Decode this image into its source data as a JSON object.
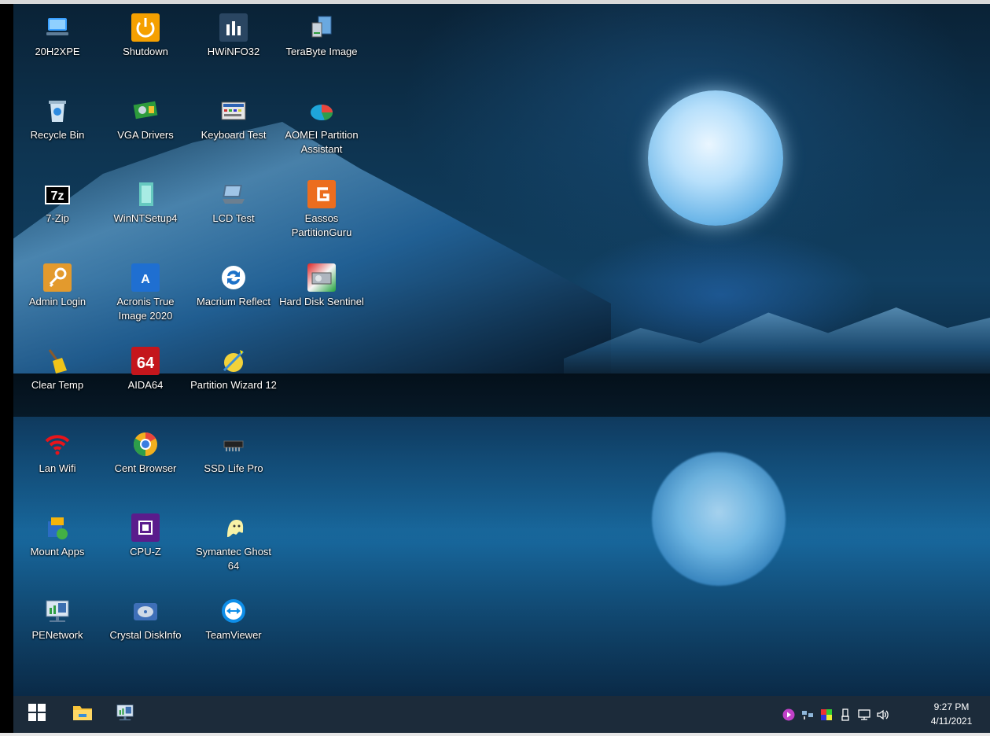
{
  "desktop": {
    "icons": [
      {
        "label": "20H2XPE",
        "icon": "computer-icon"
      },
      {
        "label": "Shutdown",
        "icon": "power-icon"
      },
      {
        "label": "HWiNFO32",
        "icon": "hwinfo-icon"
      },
      {
        "label": "TeraByte Image",
        "icon": "terabyte-icon"
      },
      {
        "label": "Recycle Bin",
        "icon": "recycle-bin-icon"
      },
      {
        "label": "VGA Drivers",
        "icon": "graphics-card-icon"
      },
      {
        "label": "Keyboard Test",
        "icon": "keyboard-icon"
      },
      {
        "label": "AOMEI Partition Assistant",
        "icon": "aomei-icon"
      },
      {
        "label": "7-Zip",
        "icon": "7zip-icon"
      },
      {
        "label": "WinNTSetup4",
        "icon": "winntsetup-icon"
      },
      {
        "label": "LCD Test",
        "icon": "laptop-icon"
      },
      {
        "label": "Eassos PartitionGuru",
        "icon": "partitionguru-icon"
      },
      {
        "label": "Admin Login",
        "icon": "key-icon"
      },
      {
        "label": "Acronis True Image 2020",
        "icon": "acronis-icon"
      },
      {
        "label": "Macrium Reflect",
        "icon": "macrium-icon"
      },
      {
        "label": "Hard Disk Sentinel",
        "icon": "hard-disk-icon"
      },
      {
        "label": "Clear Temp",
        "icon": "broom-icon"
      },
      {
        "label": "AIDA64",
        "icon": "aida64-icon"
      },
      {
        "label": "Partition Wizard 12",
        "icon": "partition-wizard-icon"
      },
      {
        "label": "Lan Wifi",
        "icon": "wifi-icon"
      },
      {
        "label": "Cent Browser",
        "icon": "browser-icon"
      },
      {
        "label": "SSD Life Pro",
        "icon": "chip-icon"
      },
      {
        "label": "Mount Apps",
        "icon": "mount-apps-icon"
      },
      {
        "label": "CPU-Z",
        "icon": "cpu-icon"
      },
      {
        "label": "Symantec Ghost 64",
        "icon": "ghost-icon"
      },
      {
        "label": "PENetwork",
        "icon": "network-icon"
      },
      {
        "label": "Crystal DiskInfo",
        "icon": "disk-info-icon"
      },
      {
        "label": "TeamViewer",
        "icon": "teamviewer-icon"
      }
    ]
  },
  "taskbar": {
    "start_icon": "windows-start-icon",
    "pinned": [
      {
        "name": "file-explorer-icon"
      },
      {
        "name": "network-icon"
      }
    ],
    "tray": [
      {
        "name": "media-player-icon"
      },
      {
        "name": "network-monitor-icon"
      },
      {
        "name": "color-icon"
      },
      {
        "name": "usb-eject-icon"
      },
      {
        "name": "network-status-icon"
      },
      {
        "name": "volume-icon"
      }
    ],
    "clock": {
      "time": "9:27 PM",
      "date": "4/11/2021"
    }
  }
}
